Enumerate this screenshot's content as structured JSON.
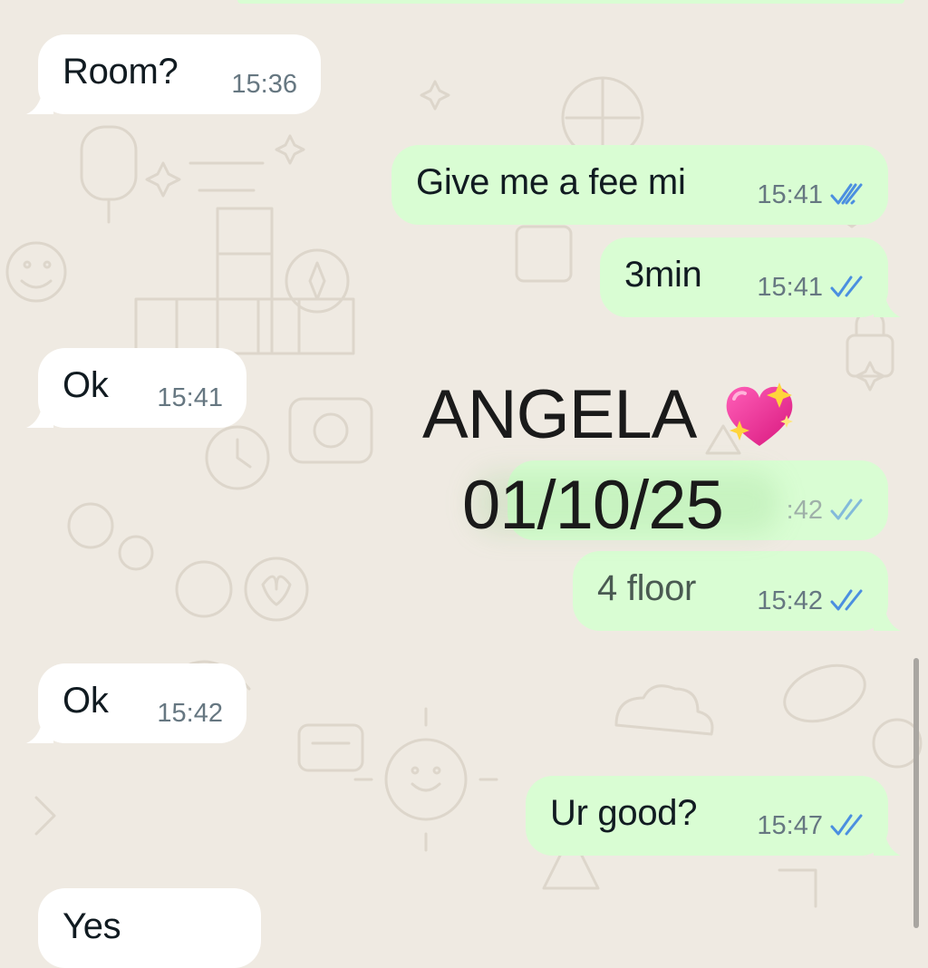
{
  "messages": [
    {
      "direction": "in",
      "text": "Room?",
      "time": "15:36"
    },
    {
      "direction": "out",
      "text": "Give me a fee mi",
      "time": "15:41",
      "read": true
    },
    {
      "direction": "out",
      "text": "3min",
      "time": "15:41",
      "read": true
    },
    {
      "direction": "in",
      "text": "Ok",
      "time": "15:41"
    },
    {
      "direction": "out",
      "text": "",
      "time": "15:42",
      "read": true,
      "time_partial": ":42"
    },
    {
      "direction": "out",
      "text": "4 floor",
      "time": "15:42",
      "read": true
    },
    {
      "direction": "in",
      "text": "Ok",
      "time": "15:42"
    },
    {
      "direction": "out",
      "text": "Ur good?",
      "time": "15:47",
      "read": true
    },
    {
      "direction": "in",
      "text": "Yes",
      "time": ""
    }
  ],
  "sticker": {
    "name": "ANGELA",
    "emoji": "sparkling-heart",
    "date": "01/10/25"
  },
  "colors": {
    "wallpaper": "#efeae2",
    "incoming": "#ffffff",
    "outgoing": "#d9fdd3",
    "read_ticks": "#53bdeb",
    "time": "#667781"
  }
}
